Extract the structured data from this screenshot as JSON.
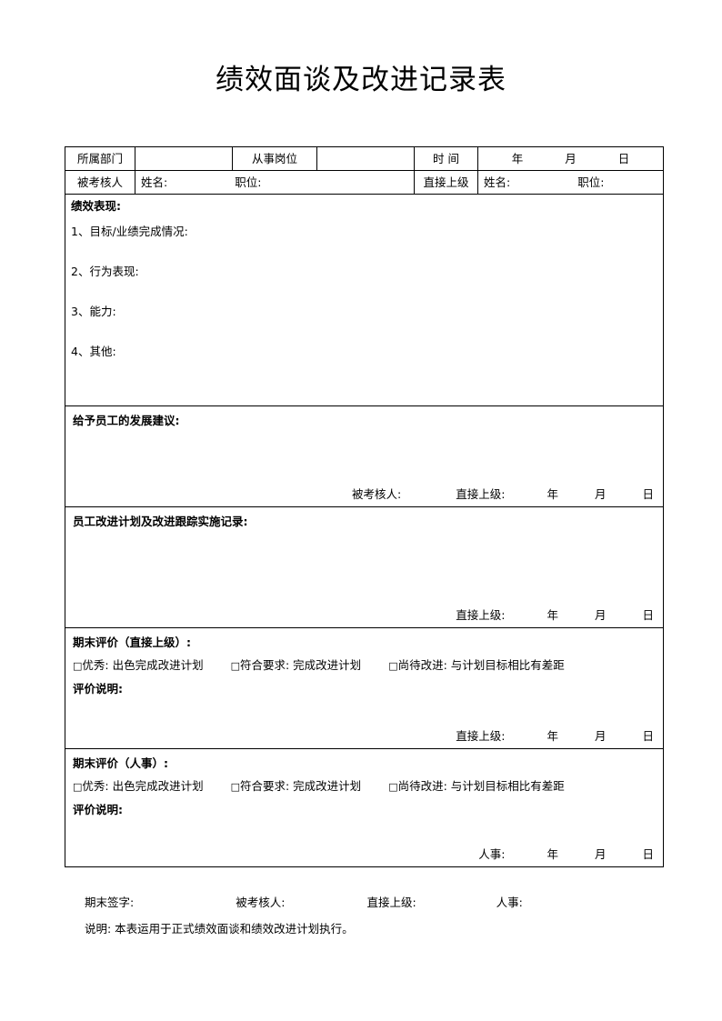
{
  "document": {
    "title": "绩效面谈及改进记录表"
  },
  "header_row1": {
    "department_label": "所属部门",
    "department_value": "",
    "position_label": "从事岗位",
    "position_value": "",
    "time_label": "时 间",
    "year": "年",
    "month": "月",
    "day": "日"
  },
  "header_row2": {
    "appraisee_label": "被考核人",
    "appraisee_name_label": "姓名:",
    "appraisee_title_label": "职位:",
    "supervisor_label": "直接上级",
    "supervisor_name_label": "姓名:",
    "supervisor_title_label": "职位:"
  },
  "performance": {
    "heading": "绩效表现:",
    "items": [
      "1、目标/业绩完成情况:",
      "2、行为表现:",
      "3、能力:",
      "4、其他:"
    ]
  },
  "development": {
    "heading": "给予员工的发展建议:",
    "sign_appraisee": "被考核人:",
    "sign_supervisor": "直接上级:",
    "year": "年",
    "month": "月",
    "day": "日"
  },
  "improvement": {
    "heading": "员工改进计划及改进跟踪实施记录:",
    "sign_supervisor": "直接上级:",
    "year": "年",
    "month": "月",
    "day": "日"
  },
  "final_eval_supervisor": {
    "heading": "期末评价（直接上级）:",
    "options": [
      {
        "checkbox": "□",
        "label": "优秀: 出色完成改进计划"
      },
      {
        "checkbox": "□",
        "label": "符合要求: 完成改进计划"
      },
      {
        "checkbox": "□",
        "label": "尚待改进: 与计划目标相比有差距"
      }
    ],
    "comment_heading": "评价说明:",
    "sign_supervisor": "直接上级:",
    "year": "年",
    "month": "月",
    "day": "日"
  },
  "final_eval_hr": {
    "heading": "期末评价（人事）:",
    "options": [
      {
        "checkbox": "□",
        "label": "优秀: 出色完成改进计划"
      },
      {
        "checkbox": "□",
        "label": "符合要求: 完成改进计划"
      },
      {
        "checkbox": "□",
        "label": "尚待改进: 与计划目标相比有差距"
      }
    ],
    "comment_heading": "评价说明:",
    "sign_hr": "人事:",
    "year": "年",
    "month": "月",
    "day": "日"
  },
  "footer": {
    "sign_label": "期末签字:",
    "sign_appraisee": "被考核人:",
    "sign_supervisor": "直接上级:",
    "sign_hr": "人事:",
    "note": "说明: 本表运用于正式绩效面谈和绩效改进计划执行。"
  }
}
